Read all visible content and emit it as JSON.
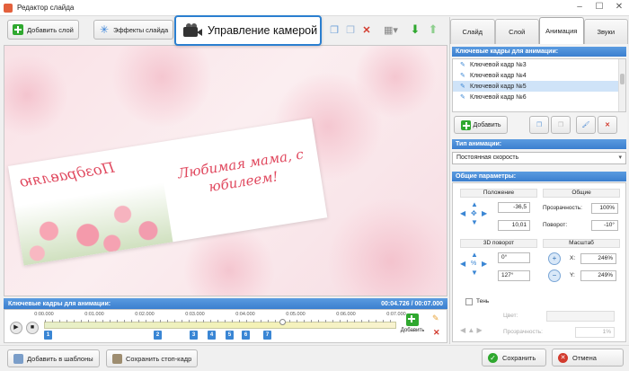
{
  "window": {
    "title": "Редактор слайда"
  },
  "toolbar": {
    "add_layer": "Добавить слой",
    "layer_effects": "Эффекты слайда",
    "camera_control": "Управление камерой"
  },
  "canvas": {
    "card_mirror_text": "Поздравляю",
    "card_greeting": "Любимая мама, с юбилеем!"
  },
  "timeline": {
    "title": "Ключевые кадры для анимации:",
    "time": "00:04.726 / 00:07.000",
    "ticks": [
      "0:00.000",
      "0:01.000",
      "0:02.000",
      "0:03.000",
      "0:04.000",
      "0:05.000",
      "0:06.000",
      "0:07.000"
    ],
    "keyframes": [
      "1",
      "2",
      "3",
      "4",
      "5",
      "6",
      "7"
    ],
    "add_label": "Добавить",
    "position_percent": 67.5
  },
  "bottom": {
    "templates": "Добавить в шаблоны",
    "save_frame": "Сохранить стоп-кадр",
    "save": "Сохранить",
    "cancel": "Отмена"
  },
  "panel": {
    "tabs": [
      "Слайд",
      "Слой",
      "Анимация",
      "Звуки"
    ],
    "active_tab": "Анимация",
    "kf_header": "Ключевые кадры для анимации:",
    "kf_items": [
      "Ключевой кадр №3",
      "Ключевой кадр №4",
      "Ключевой кадр №5",
      "Ключевой кадр №6"
    ],
    "kf_selected": "Ключевой кадр №5",
    "add_btn": "Добавить",
    "anim_type_header": "Тип анимации:",
    "anim_type_value": "Постоянная скорость",
    "params_header": "Общие параметры:",
    "position_label": "Положение",
    "position_x": "-36,5",
    "position_y": "10,01",
    "general_label": "Общие",
    "opacity_label": "Прозрачность:",
    "opacity_value": "100%",
    "rotation_label": "Поворот:",
    "rotation_value": "-10°",
    "rot3d_label": "3D поворот",
    "rot3d_x": "0°",
    "rot3d_y": "127°",
    "scale_label": "Масштаб",
    "scale_x_label": "X:",
    "scale_x": "246%",
    "scale_y_label": "Y:",
    "scale_y": "249%",
    "shadow_label": "Тень",
    "color_label": "Цвет:",
    "transparency_label": "Прозрачность:",
    "transparency_value": "1%"
  },
  "colors": {
    "accent": "#3b7fcf",
    "card_text": "#e0485e",
    "add_green": "#2fa82f",
    "delete_red": "#d23a2d"
  }
}
